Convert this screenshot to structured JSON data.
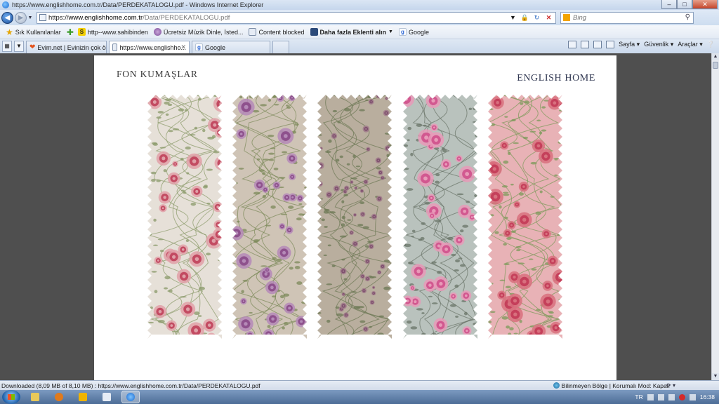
{
  "window": {
    "title": "https://www.englishhome.com.tr/Data/PERDEKATALOGU.pdf - Windows Internet Explorer",
    "minimize_label": "–",
    "maximize_label": "□",
    "close_label": "✕"
  },
  "address_bar": {
    "scheme": "https://",
    "host": "www.englishhome.com.tr",
    "path": "/Data/PERDEKATALOGU.pdf"
  },
  "search": {
    "placeholder": "Bing"
  },
  "favorites_bar": {
    "favorites_label": "Sık Kullanılanlar",
    "items": [
      {
        "label": "http--www.sahibinden",
        "icon": "sahibinden-icon"
      },
      {
        "label": "Ücretsiz Müzik Dinle, İsted...",
        "icon": "music-icon"
      },
      {
        "label": "Content blocked",
        "icon": "page-icon"
      },
      {
        "label": "Daha fazla Eklenti alın",
        "icon": "addon-icon"
      },
      {
        "label": "Google",
        "icon": "google-icon"
      }
    ]
  },
  "tabs": [
    {
      "label": "Evim.net | Evinizin çok özel...",
      "icon": "heart-icon",
      "active": false
    },
    {
      "label": "https://www.englishho...",
      "icon": "page-icon",
      "active": true
    },
    {
      "label": "Google",
      "icon": "google-icon",
      "active": false
    }
  ],
  "command_bar": {
    "page_label": "Sayfa",
    "safety_label": "Güvenlik",
    "tools_label": "Araçlar"
  },
  "pdf": {
    "left_title": "FON KUMAŞLAR",
    "right_title": "ENGLISH HOME",
    "swatches": [
      {
        "name": "cream-red-roses",
        "background": "#e6e0d8",
        "flower": "#c0405a",
        "flower2": "#e0a0a8",
        "leaf": "#8a9a6a"
      },
      {
        "name": "beige-purple-roses",
        "background": "#cfc4b6",
        "flower": "#8a4a88",
        "flower2": "#b58ab8",
        "leaf": "#7c8a5a"
      },
      {
        "name": "taupe-small-roses",
        "background": "#b9ae9e",
        "flower": "#7a4a6a",
        "flower2": "#a07a8a",
        "leaf": "#6c7854"
      },
      {
        "name": "grey-pink-floral",
        "background": "#b9c2bd",
        "flower": "#d0508c",
        "flower2": "#e89ab8",
        "leaf": "#6a7468"
      },
      {
        "name": "pink-rose-vine",
        "background": "#e8b2b6",
        "flower": "#c23a56",
        "flower2": "#d8707e",
        "leaf": "#7c9a5a"
      }
    ]
  },
  "status_bar": {
    "text": "Downloaded (8,09 MB of 8,10 MB) : https://www.englishhome.com.tr/Data/PERDEKATALOGU.pdf",
    "zone": "Bilinmeyen Bölge | Korumalı Mod: Kapalı"
  },
  "taskbar": {
    "language": "TR",
    "clock": "16:38"
  }
}
